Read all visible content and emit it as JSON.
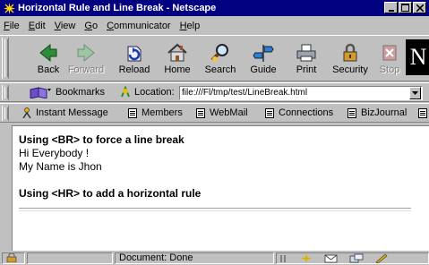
{
  "window": {
    "title": "Horizontal Rule and Line Break - Netscape"
  },
  "menu": [
    {
      "label": "File",
      "key": "F",
      "rest": "ile"
    },
    {
      "label": "Edit",
      "key": "E",
      "rest": "dit"
    },
    {
      "label": "View",
      "key": "V",
      "rest": "iew"
    },
    {
      "label": "Go",
      "key": "G",
      "rest": "o"
    },
    {
      "label": "Communicator",
      "key": "C",
      "rest": "ommunicator"
    },
    {
      "label": "Help",
      "key": "H",
      "rest": "elp"
    }
  ],
  "navigation": {
    "back": "Back",
    "forward": "Forward",
    "reload": "Reload",
    "home": "Home",
    "search": "Search",
    "guide": "Guide",
    "print": "Print",
    "security": "Security",
    "stop": "Stop"
  },
  "location_bar": {
    "bookmarks_label": "Bookmarks",
    "location_label": "Location:",
    "url": "file:///Fl/tmp/test/LineBreak.html"
  },
  "personal_toolbar": {
    "instant_message": "Instant Message",
    "members": "Members",
    "webmail": "WebMail",
    "connections": "Connections",
    "bizjournal": "BizJournal"
  },
  "page": {
    "heading1": "Using <BR> to force a line break",
    "line1": "Hi Everybody !",
    "line2": "My Name is Jhon",
    "heading2": "Using <HR> to add a horizontal rule"
  },
  "status": {
    "text": "Document: Done"
  },
  "colors": {
    "titlebar": "#000080",
    "chrome": "#c0c0c0",
    "desktop": "#ffff80"
  }
}
